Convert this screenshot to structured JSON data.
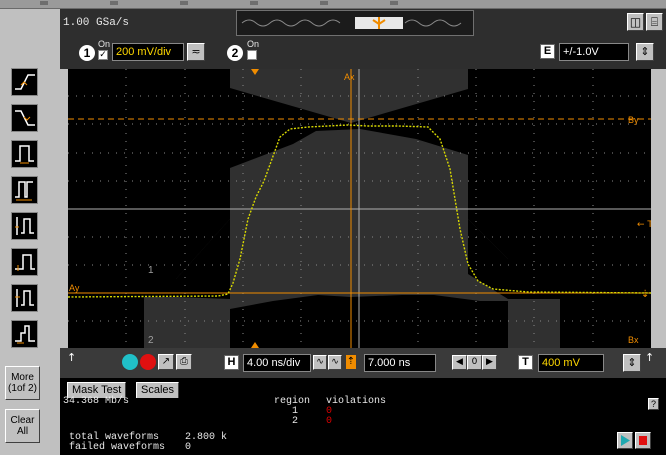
{
  "status": {
    "sample_rate": "1.00 GSa/s"
  },
  "channel1": {
    "number": "1",
    "on_label": "On",
    "checked": "✓",
    "scale": "200 mV/div",
    "coupling_icon": "ac-coupling-icon"
  },
  "channel2": {
    "number": "2",
    "on_label": "On",
    "checked": ""
  },
  "ext_trigger": {
    "label": "E",
    "level": "+/-1.0V"
  },
  "side_buttons": {
    "more_line1": "More",
    "more_line2": "(1of 2)",
    "clear_line1": "Clear",
    "clear_line2": "All"
  },
  "display": {
    "markers": {
      "ax": "Ax",
      "by": "By",
      "bx": "Bx",
      "t": "← T",
      "ay": "Ay",
      "region1": "1",
      "region2": "2"
    },
    "colors": {
      "trace": "#d8d800",
      "marker": "#f08c00",
      "mask_region": "#1e1e1e",
      "grid": "#8a8a8a"
    }
  },
  "timebase": {
    "h_label": "H",
    "scale": "4.00 ns/div",
    "delay": "7.000 ns",
    "t_label": "T",
    "trigger_level": "400 mV"
  },
  "tabs": {
    "mask_test": "Mask Test",
    "scales": "Scales"
  },
  "results": {
    "bitrate": "34.368 Mb/s",
    "region_header": "region",
    "violations_header": "violations",
    "rows": [
      {
        "region": "1",
        "violations": "0"
      },
      {
        "region": "2",
        "violations": "0"
      }
    ],
    "total_label": "total waveforms",
    "total_value": "2.800 k",
    "failed_label": "failed waveforms",
    "failed_value": "0",
    "help": "?"
  }
}
